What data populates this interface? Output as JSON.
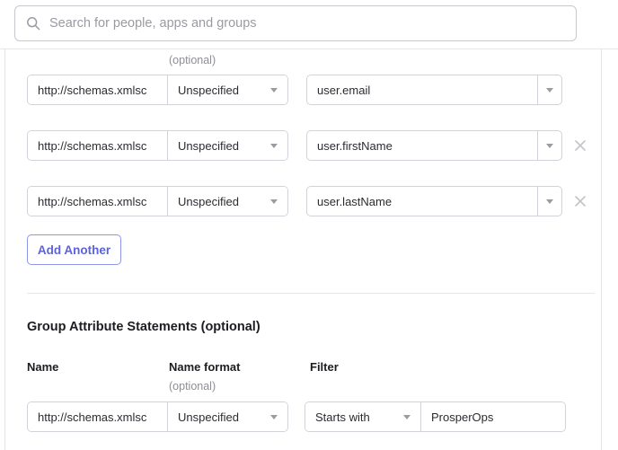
{
  "search": {
    "placeholder": "Search for people, apps and groups",
    "value": "",
    "icon": "search-icon"
  },
  "attribute_statements": {
    "name_format_optional_label": "(optional)",
    "rows": [
      {
        "name": "http://schemas.xmlsc",
        "name_format": "Unspecified",
        "value": "user.email",
        "removable": false
      },
      {
        "name": "http://schemas.xmlsc",
        "name_format": "Unspecified",
        "value": "user.firstName",
        "removable": true
      },
      {
        "name": "http://schemas.xmlsc",
        "name_format": "Unspecified",
        "value": "user.lastName",
        "removable": true
      }
    ],
    "add_another_label": "Add Another"
  },
  "group_attribute_statements": {
    "title": "Group Attribute Statements (optional)",
    "headers": {
      "name": "Name",
      "name_format": "Name format",
      "name_format_optional": "(optional)",
      "filter": "Filter"
    },
    "rows": [
      {
        "name": "http://schemas.xmlsc",
        "name_format": "Unspecified",
        "filter_type": "Starts with",
        "filter_value": "ProsperOps"
      }
    ]
  },
  "colors": {
    "accent": "#5b62e0",
    "accent_border": "#8f95ea",
    "field_border": "#d2d2d8",
    "muted_text": "#8e8e96",
    "text": "#1d1d21",
    "divider": "#e6e6ea"
  }
}
